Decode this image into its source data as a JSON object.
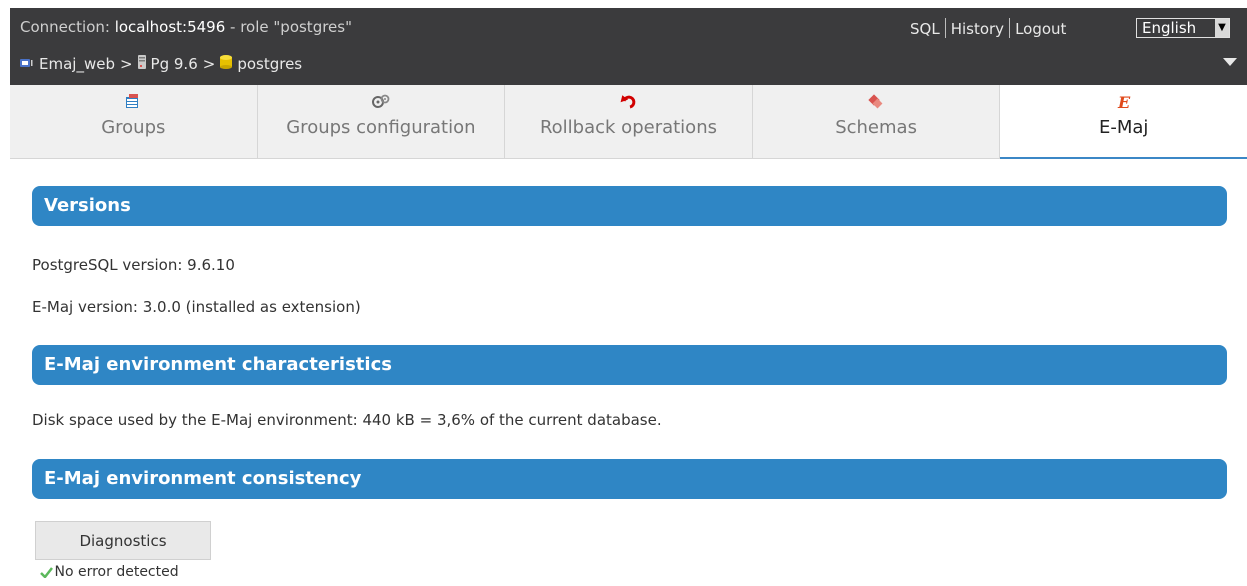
{
  "header": {
    "connection_prefix": "Connection: ",
    "connection_host": "localhost:5496",
    "connection_role": " - role \"postgres\"",
    "links": {
      "sql": "SQL",
      "history": "History",
      "logout": "Logout"
    },
    "language": {
      "selected": "English"
    },
    "breadcrumb": {
      "app": "Emaj_web",
      "server": "Pg 9.6",
      "database": "postgres",
      "separator": ">"
    }
  },
  "tabs": [
    {
      "label": "Groups",
      "icon": "groups-icon",
      "active": false
    },
    {
      "label": "Groups configuration",
      "icon": "configuration-icon",
      "active": false
    },
    {
      "label": "Rollback operations",
      "icon": "rollback-icon",
      "active": false
    },
    {
      "label": "Schemas",
      "icon": "schemas-icon",
      "active": false
    },
    {
      "label": "E-Maj",
      "icon": "emaj-icon",
      "active": true
    }
  ],
  "sections": {
    "versions": {
      "title": "Versions",
      "postgresql_version": "PostgreSQL version: 9.6.10",
      "emaj_version": "E-Maj version: 3.0.0 (installed as extension)"
    },
    "environment": {
      "title": "E-Maj environment characteristics",
      "disk_space": "Disk space used by the E-Maj environment: 440 kB = 3,6% of the current database."
    },
    "consistency": {
      "title": "E-Maj environment consistency",
      "table_header": "Diagnostics",
      "rows": [
        "No error detected"
      ]
    }
  },
  "colors": {
    "topbar": "#3b3b3d",
    "section_header": "#2f86c5",
    "tab_inactive": "#f0f0f0",
    "tab_active_underline": "#3b87c6",
    "check": "#5cb85c"
  }
}
